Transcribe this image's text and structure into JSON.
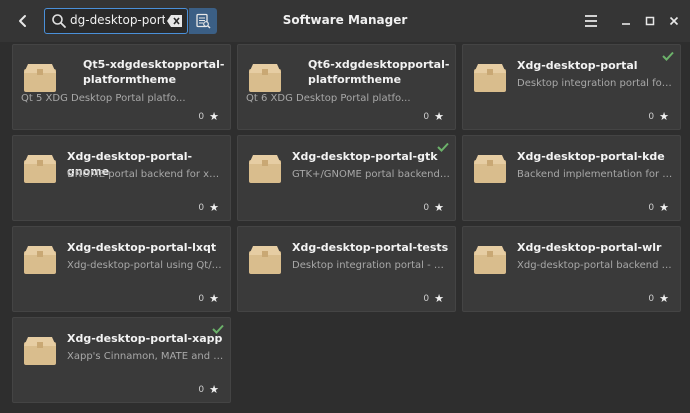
{
  "header": {
    "title": "Software Manager",
    "search_value": "dg-desktop-portal"
  },
  "icons": {
    "back": "chevron-left-icon",
    "search": "search-icon",
    "clear": "backspace-clear-icon",
    "search_mode": "search-in-description-icon",
    "menu": "hamburger-menu-icon",
    "minimize": "minimize-icon",
    "maximize": "maximize-icon",
    "close": "close-icon",
    "package": "package-box-icon",
    "installed": "checkmark-icon",
    "star": "star-icon"
  },
  "colors": {
    "accent": "#4a90d9",
    "installed_check": "#6cb26a",
    "package_box": "#d9bd8d"
  },
  "packages": [
    {
      "title": "Qt5-xdgdesktopportal-platformtheme",
      "description": "Qt 5 XDG Desktop Portal platfo...",
      "rating": "0",
      "installed": false
    },
    {
      "title": "Qt6-xdgdesktopportal-platformtheme",
      "description": "Qt 6 XDG Desktop Portal platfo...",
      "rating": "0",
      "installed": false
    },
    {
      "title": "Xdg-desktop-portal",
      "description": "Desktop integration portal for ...",
      "rating": "0",
      "installed": true
    },
    {
      "title": "Xdg-desktop-portal-gnome",
      "description": "GNOME portal backend for xdg...",
      "rating": "0",
      "installed": false
    },
    {
      "title": "Xdg-desktop-portal-gtk",
      "description": "GTK+/GNOME portal backend f...",
      "rating": "0",
      "installed": true
    },
    {
      "title": "Xdg-desktop-portal-kde",
      "description": "Backend implementation for x...",
      "rating": "0",
      "installed": false
    },
    {
      "title": "Xdg-desktop-portal-lxqt",
      "description": "Xdg-desktop-portal using Qt/KF...",
      "rating": "0",
      "installed": false
    },
    {
      "title": "Xdg-desktop-portal-tests",
      "description": "Desktop integration portal - au...",
      "rating": "0",
      "installed": false
    },
    {
      "title": "Xdg-desktop-portal-wlr",
      "description": "Xdg-desktop-portal backend fo...",
      "rating": "0",
      "installed": false
    },
    {
      "title": "Xdg-desktop-portal-xapp",
      "description": "Xapp's Cinnamon, MATE and XF...",
      "rating": "0",
      "installed": true
    }
  ]
}
